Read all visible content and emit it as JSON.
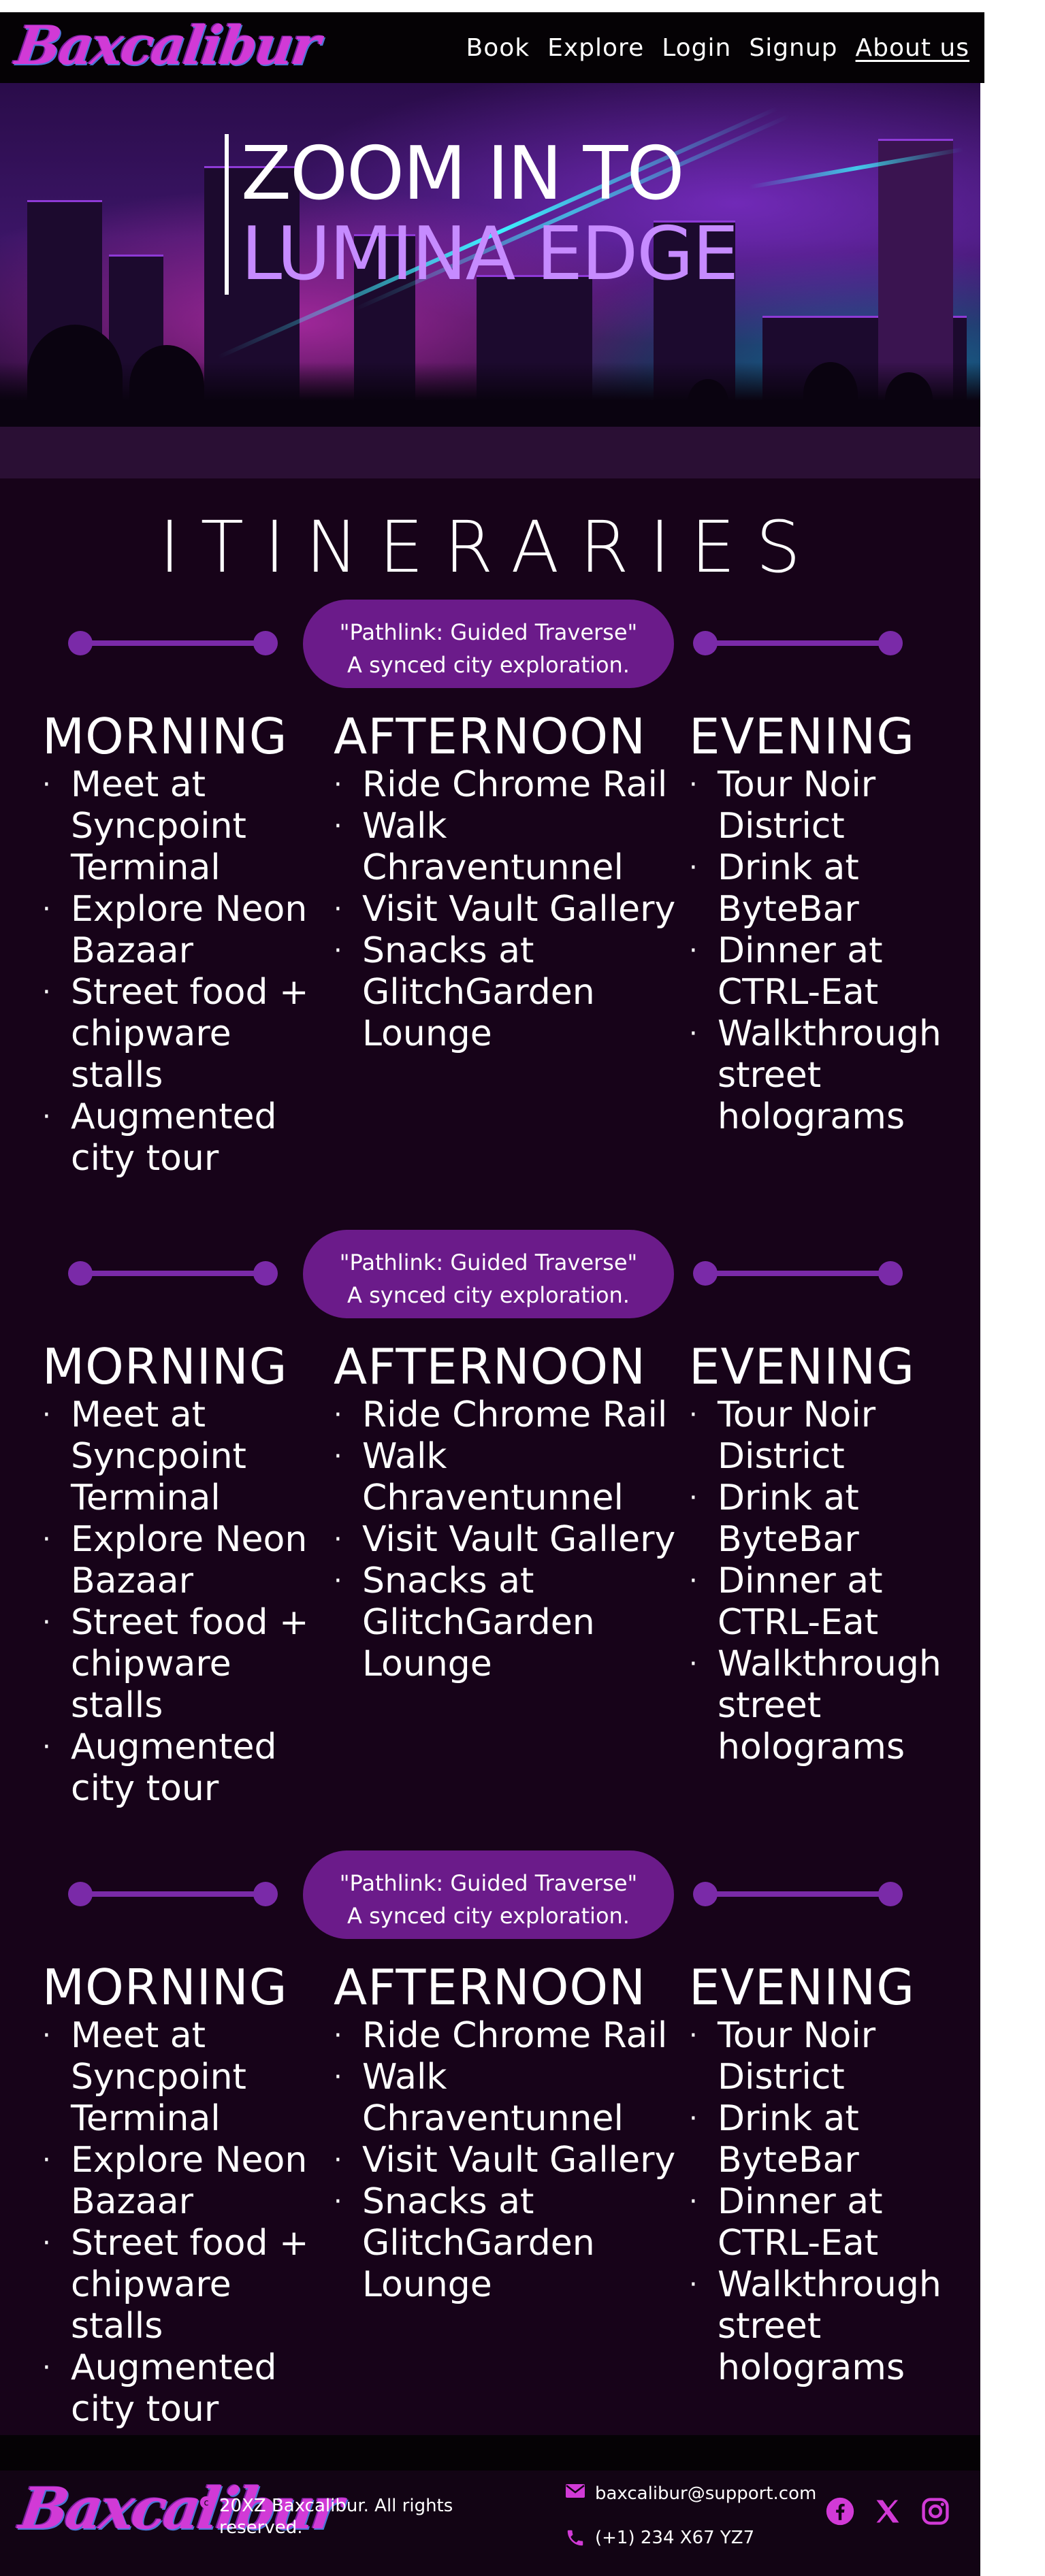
{
  "brand": {
    "logo_text": "Baxcalibur",
    "accent": "#d13ad6",
    "pill_color": "#6b1b8a",
    "background": "#170319"
  },
  "nav": {
    "links": [
      {
        "label": "Book"
      },
      {
        "label": "Explore"
      },
      {
        "label": "Login"
      },
      {
        "label": "Signup"
      },
      {
        "label": "About us",
        "active": true
      }
    ]
  },
  "hero": {
    "line1": "ZOOM IN TO",
    "line2": "LUMINA EDGE"
  },
  "itineraries": {
    "title": "ITINERARIES",
    "blocks": [
      {
        "pill_line1": "\"Pathlink: Guided Traverse\"",
        "pill_line2": "A synced city exploration.",
        "morning": {
          "heading": "MORNING",
          "items": [
            "Meet at Syncpoint Terminal",
            "Explore Neon Bazaar",
            "Street food + chipware stalls",
            "Augmented city tour"
          ]
        },
        "afternoon": {
          "heading": "AFTERNOON",
          "items": [
            "Ride Chrome Rail",
            "Walk Chraventunnel",
            "Visit Vault Gallery",
            "Snacks at GlitchGarden Lounge"
          ]
        },
        "evening": {
          "heading": "EVENING",
          "items": [
            "Tour Noir District",
            "Drink at ByteBar",
            "Dinner at CTRL-Eat",
            "Walkthrough street holograms"
          ]
        }
      },
      {
        "pill_line1": "\"Pathlink: Guided Traverse\"",
        "pill_line2": "A synced city exploration.",
        "morning": {
          "heading": "MORNING",
          "items": [
            "Meet at Syncpoint Terminal",
            "Explore Neon Bazaar",
            "Street food + chipware stalls",
            "Augmented city tour"
          ]
        },
        "afternoon": {
          "heading": "AFTERNOON",
          "items": [
            "Ride Chrome Rail",
            "Walk Chraventunnel",
            "Visit Vault Gallery",
            "Snacks at GlitchGarden Lounge"
          ]
        },
        "evening": {
          "heading": "EVENING",
          "items": [
            "Tour Noir District",
            "Drink at ByteBar",
            "Dinner at CTRL-Eat",
            "Walkthrough street holograms"
          ]
        }
      },
      {
        "pill_line1": "\"Pathlink: Guided Traverse\"",
        "pill_line2": "A synced city exploration.",
        "morning": {
          "heading": "MORNING",
          "items": [
            "Meet at Syncpoint Terminal",
            "Explore Neon Bazaar",
            "Street food + chipware stalls",
            "Augmented city tour"
          ]
        },
        "afternoon": {
          "heading": "AFTERNOON",
          "items": [
            "Ride Chrome Rail",
            "Walk Chraventunnel",
            "Visit Vault Gallery",
            "Snacks at GlitchGarden Lounge"
          ]
        },
        "evening": {
          "heading": "EVENING",
          "items": [
            "Tour Noir District",
            "Drink at ByteBar",
            "Dinner at CTRL-Eat",
            "Walkthrough street holograms"
          ]
        }
      }
    ]
  },
  "footer": {
    "logo_text": "Baxcalibur",
    "copyright": "20XZ Baxcalibur. All rights reserved.",
    "email": "baxcalibur@support.com",
    "phone": "(+1) 234 X67 YZ7",
    "socials": [
      {
        "icon": "facebook-icon"
      },
      {
        "icon": "x-icon"
      },
      {
        "icon": "instagram-icon"
      }
    ]
  }
}
